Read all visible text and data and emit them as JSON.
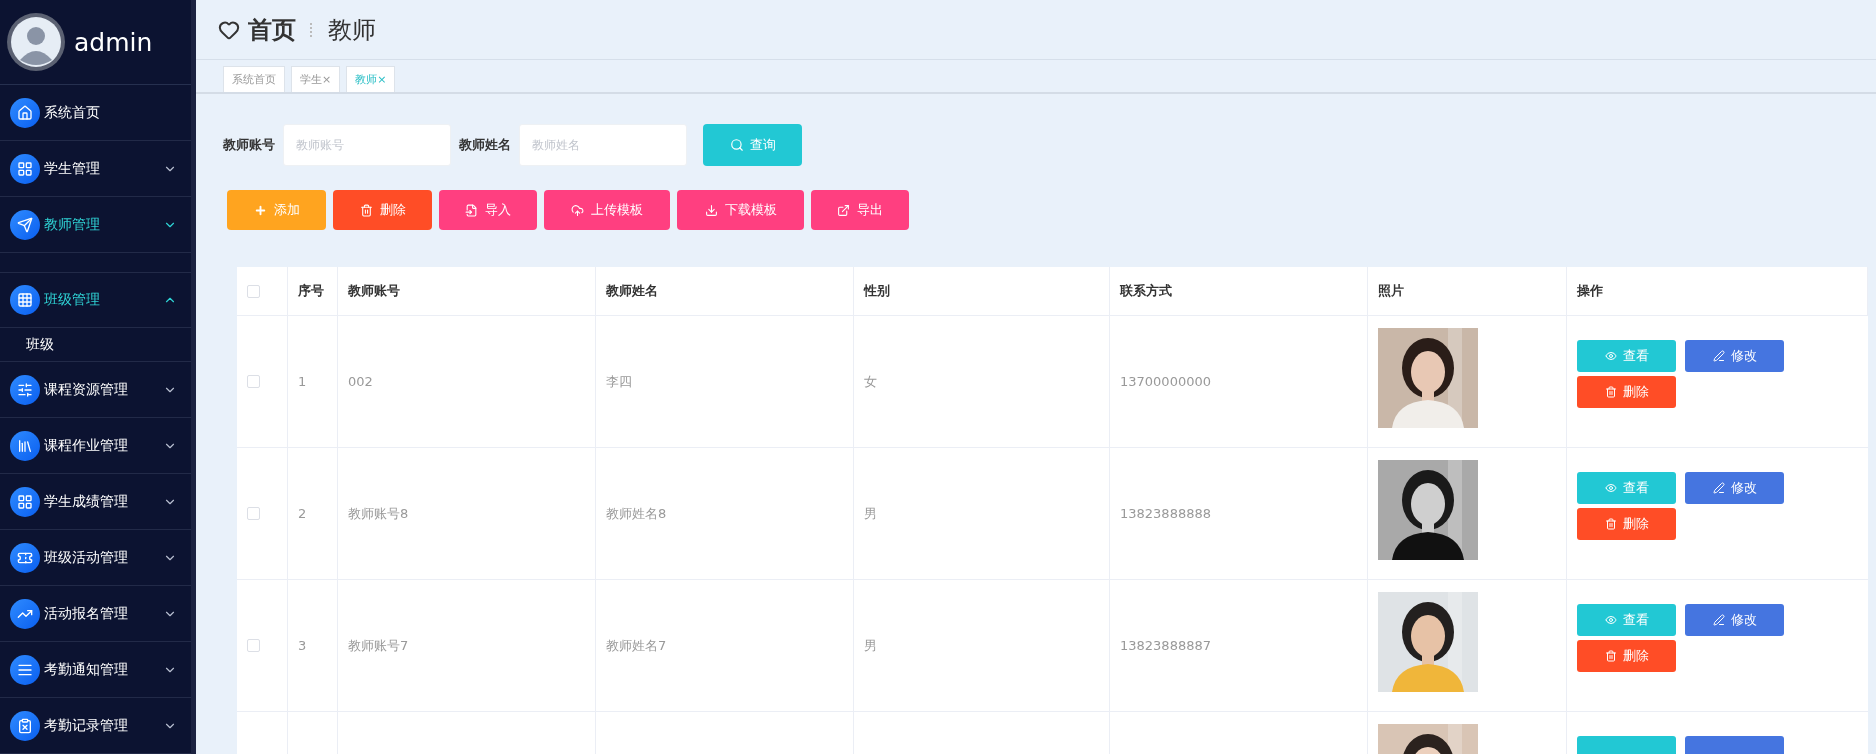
{
  "sidebar": {
    "user": "admin",
    "items": [
      {
        "label": "系统首页",
        "kind": "link",
        "selected": false,
        "expanded": false
      },
      {
        "label": "学生管理",
        "kind": "menu",
        "selected": false,
        "expanded": false
      },
      {
        "label": "教师管理",
        "kind": "menu",
        "selected": true,
        "expanded": false
      },
      {
        "label": "班级管理",
        "kind": "menu",
        "selected": true,
        "expanded": true,
        "children": [
          {
            "label": "班级"
          }
        ]
      },
      {
        "label": "课程资源管理",
        "kind": "menu",
        "selected": false,
        "expanded": false
      },
      {
        "label": "课程作业管理",
        "kind": "menu",
        "selected": false,
        "expanded": false
      },
      {
        "label": "学生成绩管理",
        "kind": "menu",
        "selected": false,
        "expanded": false
      },
      {
        "label": "班级活动管理",
        "kind": "menu",
        "selected": false,
        "expanded": false
      },
      {
        "label": "活动报名管理",
        "kind": "menu",
        "selected": false,
        "expanded": false
      },
      {
        "label": "考勤通知管理",
        "kind": "menu",
        "selected": false,
        "expanded": false
      },
      {
        "label": "考勤记录管理",
        "kind": "menu",
        "selected": false,
        "expanded": false
      }
    ]
  },
  "breadcrumb": {
    "home": "首页",
    "current": "教师"
  },
  "tabs": [
    {
      "label": "系统首页",
      "selected": false
    },
    {
      "label": "学生",
      "close": "×",
      "selected": false
    },
    {
      "label": "教师",
      "close": "×",
      "selected": true
    }
  ],
  "search": {
    "fields": [
      {
        "label": "教师账号",
        "placeholder": "教师账号"
      },
      {
        "label": "教师姓名",
        "placeholder": "教师姓名"
      }
    ],
    "button": "查询"
  },
  "toolbar": [
    {
      "kind": "add",
      "label": "添加"
    },
    {
      "kind": "delete",
      "label": "删除"
    },
    {
      "kind": "import",
      "label": "导入"
    },
    {
      "kind": "upload",
      "label": "上传模板"
    },
    {
      "kind": "download",
      "label": "下载模板"
    },
    {
      "kind": "export",
      "label": "导出"
    }
  ],
  "table": {
    "header_checked": false,
    "columns": [
      "序号",
      "教师账号",
      "教师姓名",
      "性别",
      "联系方式",
      "照片",
      "操作"
    ],
    "rows": [
      {
        "checked": false,
        "index": "1",
        "account": "002",
        "name": "李四",
        "gender": "女",
        "phone": "13700000000",
        "photo": {
          "kind": "picture"
        },
        "actions": [
          {
            "kind": "view",
            "label": "查看"
          },
          {
            "kind": "edit",
            "label": "修改"
          },
          {
            "kind": "delete",
            "label": "删除"
          }
        ]
      },
      {
        "checked": false,
        "index": "2",
        "account": "教师账号8",
        "name": "教师姓名8",
        "gender": "男",
        "phone": "13823888888",
        "photo": {
          "kind": "picture"
        },
        "actions": [
          {
            "kind": "view",
            "label": "查看"
          },
          {
            "kind": "edit",
            "label": "修改"
          },
          {
            "kind": "delete",
            "label": "删除"
          }
        ]
      },
      {
        "checked": false,
        "index": "3",
        "account": "教师账号7",
        "name": "教师姓名7",
        "gender": "男",
        "phone": "13823888887",
        "photo": {
          "kind": "picture"
        },
        "actions": [
          {
            "kind": "view",
            "label": "查看"
          },
          {
            "kind": "edit",
            "label": "修改"
          },
          {
            "kind": "delete",
            "label": "删除"
          }
        ]
      },
      {
        "photo": {
          "kind": "picture"
        },
        "actions": [
          {
            "kind": "view"
          },
          {
            "kind": "edit"
          }
        ]
      }
    ]
  }
}
